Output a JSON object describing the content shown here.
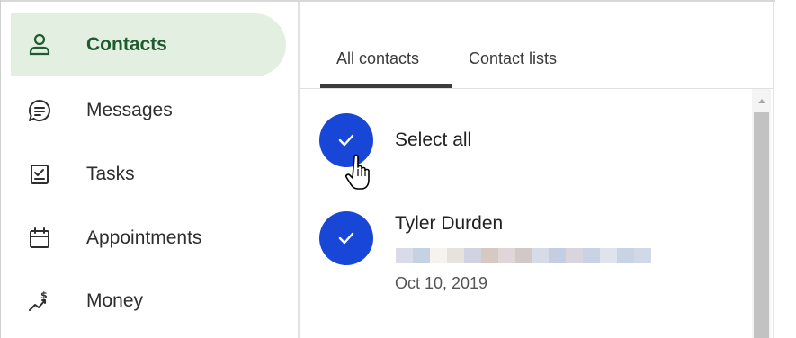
{
  "sidebar": {
    "items": [
      {
        "label": "Contacts",
        "icon": "person-icon",
        "active": true
      },
      {
        "label": "Messages",
        "icon": "chat-bubble-icon",
        "active": false
      },
      {
        "label": "Tasks",
        "icon": "task-checklist-icon",
        "active": false
      },
      {
        "label": "Appointments",
        "icon": "calendar-icon",
        "active": false
      },
      {
        "label": "Money",
        "icon": "money-trend-icon",
        "active": false
      }
    ]
  },
  "tabs": [
    {
      "label": "All contacts",
      "active": true
    },
    {
      "label": "Contact lists",
      "active": false
    }
  ],
  "list": {
    "select_all_label": "Select all",
    "contacts": [
      {
        "name": "Tyler Durden",
        "date": "Oct 10, 2019",
        "checked": true
      }
    ]
  },
  "colors": {
    "accent_blue": "#1846d6",
    "active_nav_bg": "#e3efe0",
    "active_nav_text": "#1f5a31"
  }
}
